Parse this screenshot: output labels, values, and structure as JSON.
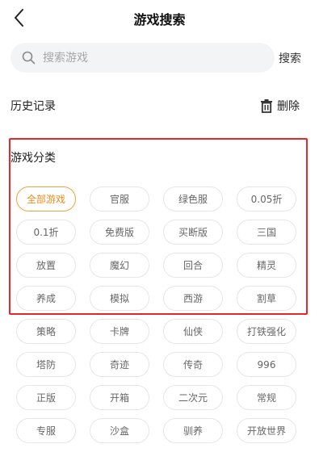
{
  "header": {
    "title": "游戏搜索",
    "back_icon": "chevron-left-icon"
  },
  "search": {
    "placeholder": "搜索游戏",
    "value": "",
    "button_label": "搜索",
    "icon": "search-icon"
  },
  "history": {
    "title": "历史记录",
    "delete_label": "删除",
    "delete_icon": "trash-icon"
  },
  "categories": {
    "title": "游戏分类",
    "active_color": "#f08a1e",
    "highlight_frame_color": "#e5262b",
    "selected_index": 0,
    "items": [
      {
        "label": "全部游戏"
      },
      {
        "label": "官服"
      },
      {
        "label": "绿色服"
      },
      {
        "label": "0.05折"
      },
      {
        "label": "0.1折"
      },
      {
        "label": "免费版"
      },
      {
        "label": "买断版"
      },
      {
        "label": "三国"
      },
      {
        "label": "放置"
      },
      {
        "label": "魔幻"
      },
      {
        "label": "回合"
      },
      {
        "label": "精灵"
      },
      {
        "label": "养成"
      },
      {
        "label": "模拟"
      },
      {
        "label": "西游"
      },
      {
        "label": "割草"
      },
      {
        "label": "策略"
      },
      {
        "label": "卡牌"
      },
      {
        "label": "仙侠"
      },
      {
        "label": "打铁强化"
      },
      {
        "label": "塔防"
      },
      {
        "label": "奇迹"
      },
      {
        "label": "传奇"
      },
      {
        "label": "996"
      },
      {
        "label": "正版"
      },
      {
        "label": "开箱"
      },
      {
        "label": "二次元"
      },
      {
        "label": "常规"
      },
      {
        "label": "专服"
      },
      {
        "label": "沙盒"
      },
      {
        "label": "驯养"
      },
      {
        "label": "开放世界"
      }
    ]
  }
}
